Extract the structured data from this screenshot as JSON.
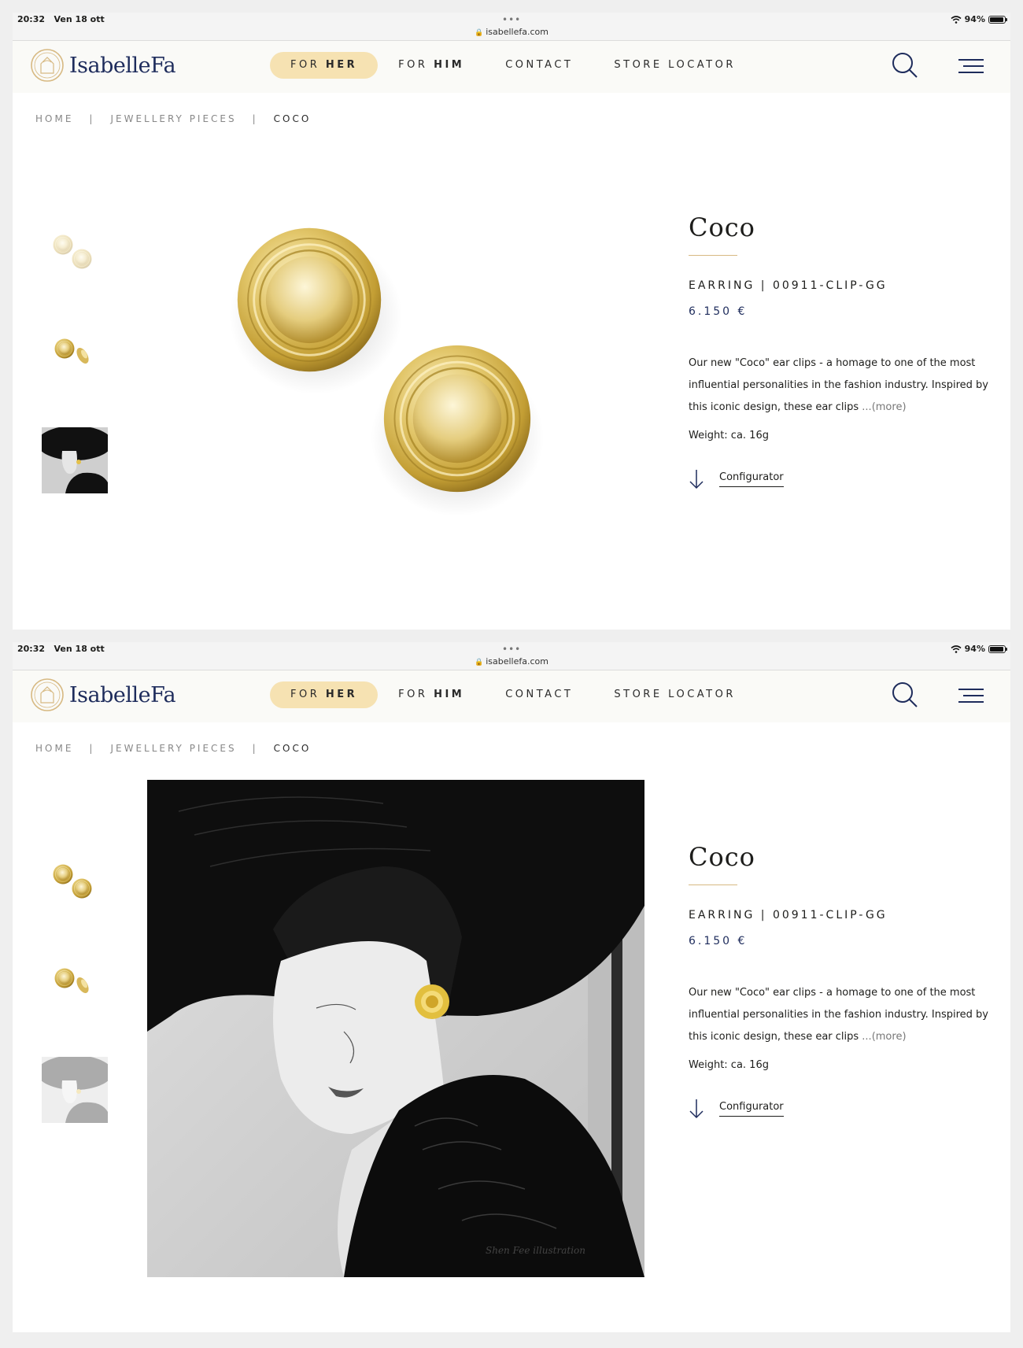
{
  "status_bar": {
    "time": "20:32",
    "date": "Ven 18 ott",
    "url": "isabellefa.com",
    "battery": "94%"
  },
  "brand": {
    "name": "IsabelleFa",
    "mark": "IF"
  },
  "nav": {
    "for_her": {
      "prefix": "FOR",
      "bold": "HER"
    },
    "for_him": {
      "prefix": "FOR",
      "bold": "HIM"
    },
    "contact": "CONTACT",
    "store_locator": "STORE LOCATOR"
  },
  "breadcrumb": {
    "home": "HOME",
    "section": "JEWELLERY PIECES",
    "current": "COCO",
    "separator": "|"
  },
  "product": {
    "title": "Coco",
    "type": "EARRING",
    "sku": "00911-CLIP-GG",
    "meta_separator": "|",
    "price": "6.150 €",
    "description": "Our new \"Coco\" ear clips - a homage to one of the most influential personalities in the fashion industry. Inspired by this iconic design, these ear clips ",
    "more": "...(more)",
    "weight": "Weight: ca. 16g",
    "configurator": "Configurator"
  },
  "illustration_signature": "Shen Fee illustration",
  "colors": {
    "accent_pill": "#f6e2b2",
    "gold": "#d7b982",
    "navy": "#1e2c5c"
  }
}
